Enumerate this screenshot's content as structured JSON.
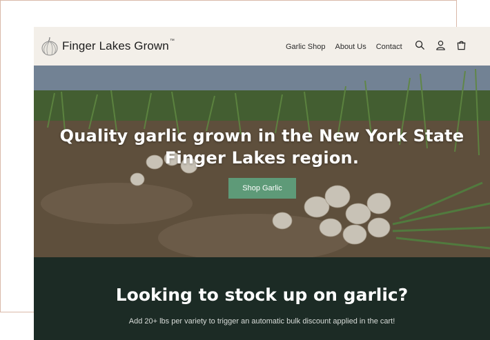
{
  "brand": {
    "name": "Finger Lakes Grown",
    "trademark": "™"
  },
  "nav": {
    "items": [
      "Garlic Shop",
      "About Us",
      "Contact"
    ]
  },
  "header_icons": [
    "search-icon",
    "account-icon",
    "cart-icon"
  ],
  "hero": {
    "title": "Quality garlic grown in the New York State Finger Lakes region.",
    "cta_label": "Shop Garlic"
  },
  "promo": {
    "title": "Looking to stock up on garlic?",
    "subtitle": "Add 20+ lbs per variety to trigger an automatic bulk discount applied in the cart!"
  },
  "colors": {
    "header_bg": "#f3efe9",
    "cta_green": "#5e9a78",
    "dark_green": "#1c2b25",
    "frame_border": "#d9b8a8"
  }
}
